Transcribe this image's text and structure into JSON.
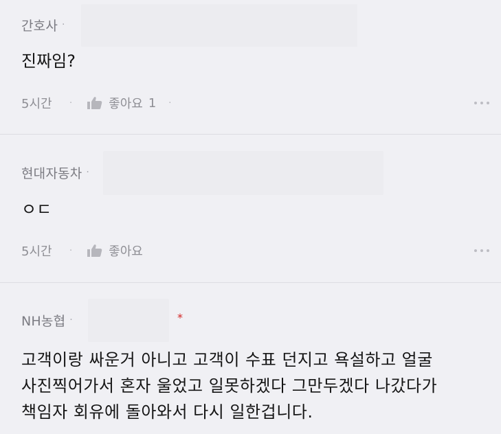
{
  "comments": [
    {
      "company": "간호사",
      "dot": "·",
      "text_lines": [
        "진짜임?"
      ],
      "time": "5시간",
      "like_label": "좋아요",
      "like_count": "1"
    },
    {
      "company": "현대자동차",
      "dot": "·",
      "text_lines": [
        "ㅇㄷ"
      ],
      "time": "5시간",
      "like_label": "좋아요",
      "like_count": ""
    },
    {
      "company": "NH농협",
      "dot": "·",
      "required_mark": "*",
      "text_lines": [
        "고객이랑 싸운거 아니고 고객이 수표 던지고 욕설하고 얼굴",
        "사진찍어가서 혼자 울었고 일못하겠다 그만두겠다 나갔다가",
        "책임자 회유에 돌아와서 다시 일한겁니다."
      ]
    }
  ],
  "icons": {
    "like": "thumbs-up-icon",
    "more": "more-horizontal-icon"
  },
  "colors": {
    "background": "#f0f0f4",
    "meta_text": "#7b7b82",
    "body_text": "#151515",
    "accent_red": "#d22424",
    "divider": "#dcdce2"
  }
}
